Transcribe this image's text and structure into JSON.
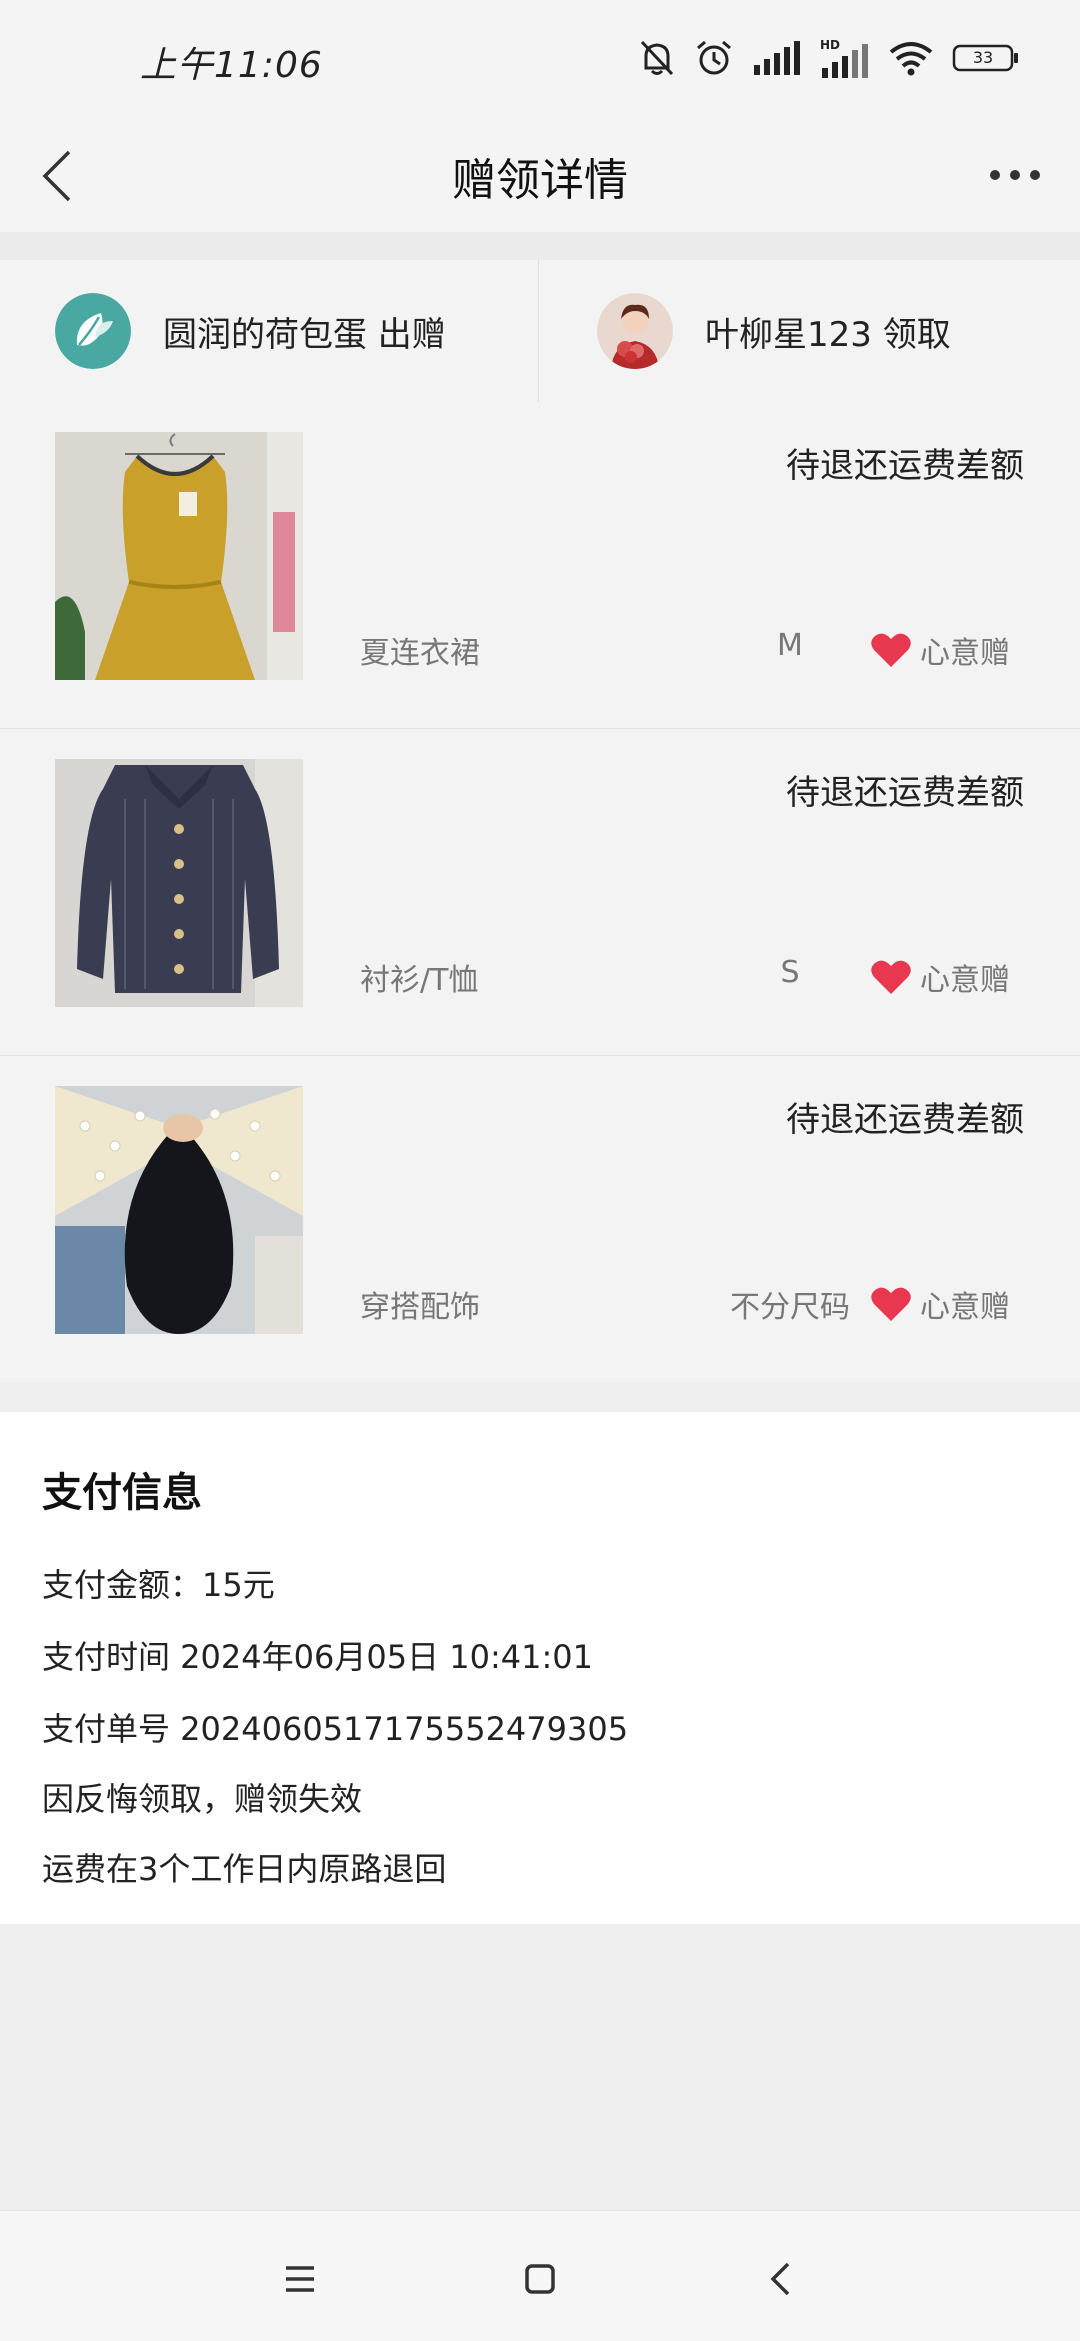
{
  "status_bar": {
    "time": "上午11:06",
    "battery": "33",
    "icons": [
      "mute-bell-icon",
      "alarm-icon",
      "signal-icon",
      "hd-signal-icon",
      "wifi-icon",
      "battery-icon"
    ]
  },
  "header": {
    "title": "赠领详情",
    "back_icon": "chevron-left-icon",
    "more_icon": "more-dots-icon"
  },
  "parties": {
    "giver": {
      "label": "圆润的荷包蛋 出赠",
      "avatar": "leaf-avatar"
    },
    "receiver": {
      "label": "叶柳星123 领取",
      "avatar": "portrait-avatar"
    }
  },
  "items": [
    {
      "status": "待退还运费差额",
      "category": "夏连衣裙",
      "size": "M",
      "gift_label": "心意赠",
      "image": "yellow-dress"
    },
    {
      "status": "待退还运费差额",
      "category": "衬衫/T恤",
      "size": "S",
      "gift_label": "心意赠",
      "image": "navy-shirt"
    },
    {
      "status": "待退还运费差额",
      "category": "穿搭配饰",
      "size": "不分尺码",
      "gift_label": "心意赠",
      "image": "pearl-bow"
    }
  ],
  "payment": {
    "title": "支付信息",
    "amount": "支付金额：15元",
    "time": "支付时间 2024年06月05日 10:41:01",
    "order_no": "支付单号 20240605171755524793​05",
    "reason": "因反悔领取，赠领失效",
    "refund_note": "运费在3个工作日内原路退回"
  },
  "colors": {
    "accent_heart": "#e8384f",
    "avatar_teal": "#4aa8a3"
  },
  "navigation": {
    "menu_icon": "menu-icon",
    "home_icon": "home-square-icon",
    "back_icon": "back-chevron-icon"
  }
}
